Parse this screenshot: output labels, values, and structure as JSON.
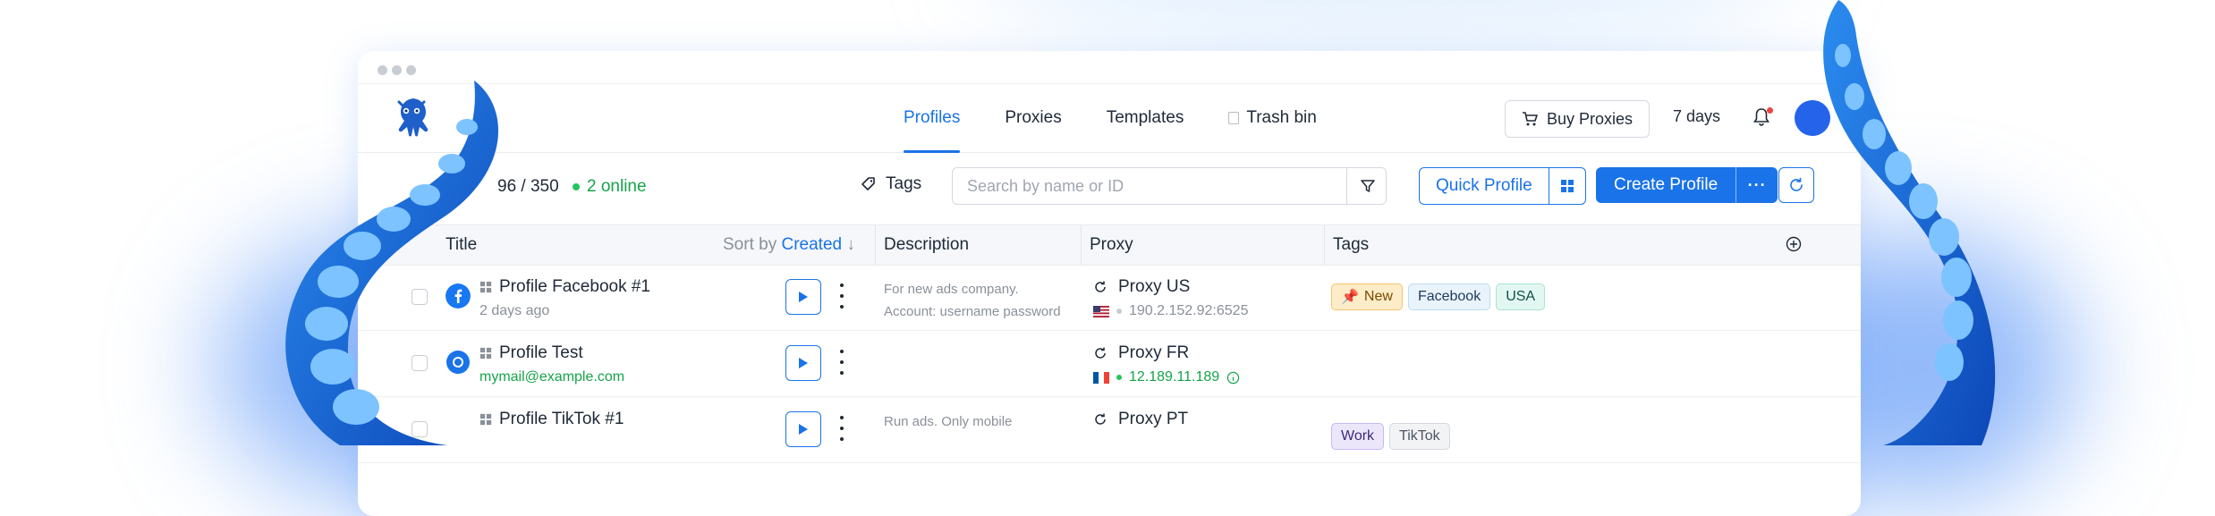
{
  "nav": {
    "tabs": [
      {
        "label": "Profiles",
        "active": true
      },
      {
        "label": "Proxies",
        "active": false
      },
      {
        "label": "Templates",
        "active": false
      },
      {
        "label": "Trash bin",
        "active": false
      }
    ]
  },
  "header": {
    "buy_proxies_label": "Buy Proxies",
    "days_left": "7 days"
  },
  "toolbar": {
    "profile_count": "96 / 350",
    "online": "2 online",
    "tags_label": "Tags",
    "search_placeholder": "Search by name or ID",
    "quick_profile_label": "Quick Profile",
    "create_profile_label": "Create Profile"
  },
  "table": {
    "headers": {
      "title": "Title",
      "sort_by": "Sort by",
      "sort_field": "Created",
      "description": "Description",
      "proxy": "Proxy",
      "tags": "Tags"
    },
    "rows": [
      {
        "title": "Profile Facebook #1",
        "subtitle": "2 days ago",
        "description_lines": [
          "For new ads company.",
          "Account: username password"
        ],
        "proxy_name": "Proxy US",
        "proxy_address": "190.2.152.92:6525",
        "tags": [
          "New",
          "Facebook",
          "USA"
        ]
      },
      {
        "title": "Profile Test",
        "subtitle": "mymail@example.com",
        "description_lines": [],
        "proxy_name": "Proxy FR",
        "proxy_address": "12.189.11.189",
        "tags": []
      },
      {
        "title": "Profile TikTok #1",
        "subtitle": "",
        "description_lines": [
          "Run ads. Only mobile"
        ],
        "proxy_name": "Proxy PT",
        "proxy_address": "",
        "tags": [
          "Work",
          "TikTok"
        ]
      }
    ]
  },
  "colors": {
    "accent": "#1a73e8",
    "online": "#16a34a",
    "tentacle": "#1e6fe0"
  }
}
